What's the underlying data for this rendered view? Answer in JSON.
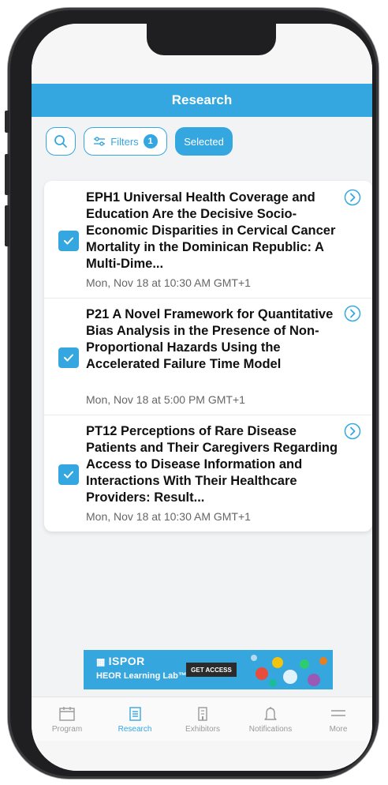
{
  "header": {
    "title": "Research"
  },
  "toolbar": {
    "search_icon": "search-icon",
    "filters_label": "Filters",
    "filters_count": "1",
    "selected_label": "Selected"
  },
  "items": [
    {
      "title": "EPH1 Universal Health Coverage and Education Are the Decisive Socio-Economic Disparities in Cervical Cancer Mortality in the Dominican Republic: A Multi-Dime...",
      "date": "Mon, Nov 18 at 10:30 AM GMT+1",
      "checked": true
    },
    {
      "title": "P21 A Novel Framework for Quantitative Bias Analysis in the Presence of Non-Proportional Hazards Using the Accelerated Failure Time Model",
      "date": "Mon, Nov 18 at 5:00 PM GMT+1",
      "checked": true
    },
    {
      "title": "PT12 Perceptions of Rare Disease Patients and Their Caregivers Regarding Access to Disease Information and Interactions With Their Healthcare Providers: Result...",
      "date": "Mon, Nov 18 at 10:30 AM GMT+1",
      "checked": true
    }
  ],
  "banner": {
    "brand": "ISPOR",
    "product": "HEOR Learning Lab™",
    "cta": "GET ACCESS"
  },
  "tabbar": {
    "tabs": [
      {
        "label": "Program",
        "icon": "calendar-icon",
        "active": false
      },
      {
        "label": "Research",
        "icon": "document-icon",
        "active": true
      },
      {
        "label": "Exhibitors",
        "icon": "building-icon",
        "active": false
      },
      {
        "label": "Notifications",
        "icon": "bell-icon",
        "active": false
      },
      {
        "label": "More",
        "icon": "menu-icon",
        "active": false
      }
    ]
  },
  "colors": {
    "accent": "#35a7e0",
    "text": "#111111",
    "muted": "#666666"
  }
}
